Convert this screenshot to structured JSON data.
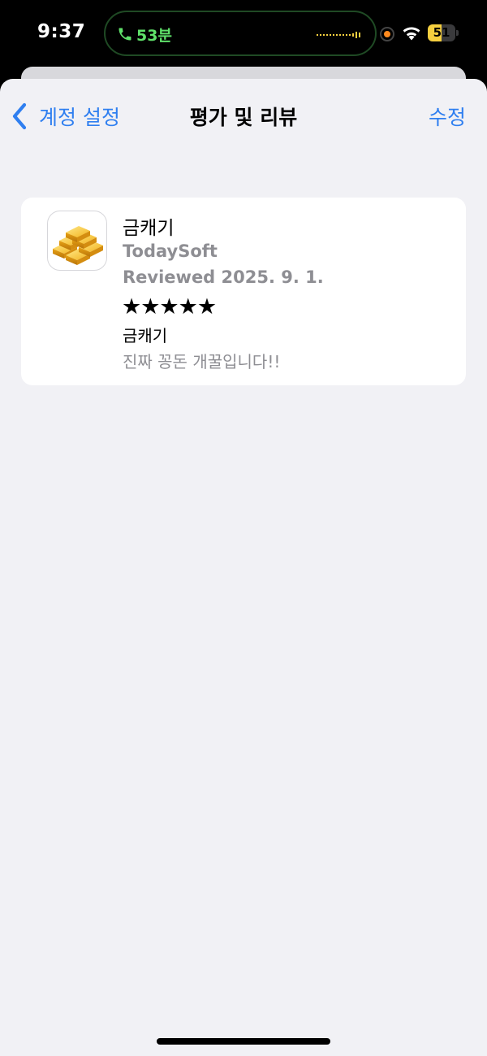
{
  "status_bar": {
    "time": "9:37",
    "call_duration": "53분",
    "battery_level": "51",
    "battery_fraction": 0.51,
    "icons": [
      "phone-icon",
      "waveform-icon",
      "recording-dot-icon",
      "wifi-icon",
      "battery-icon"
    ],
    "colors": {
      "call_accent": "#5fe06a",
      "battery_accent": "#f5cf3f",
      "recording": "#ff8a1e"
    }
  },
  "nav": {
    "back_label": "계정 설정",
    "title": "평가 및 리뷰",
    "edit_label": "수정",
    "accent_color": "#2f7ff0"
  },
  "review": {
    "app_name": "금캐기",
    "app_icon": "gold-bars-icon",
    "developer": "TodaySoft",
    "reviewed_date": "Reviewed 2025. 9. 1.",
    "rating": 5,
    "rating_max": 5,
    "stars": "★★★★★",
    "title": "금캐기",
    "body": "진짜 꽁돈 개꿀입니다!!"
  }
}
